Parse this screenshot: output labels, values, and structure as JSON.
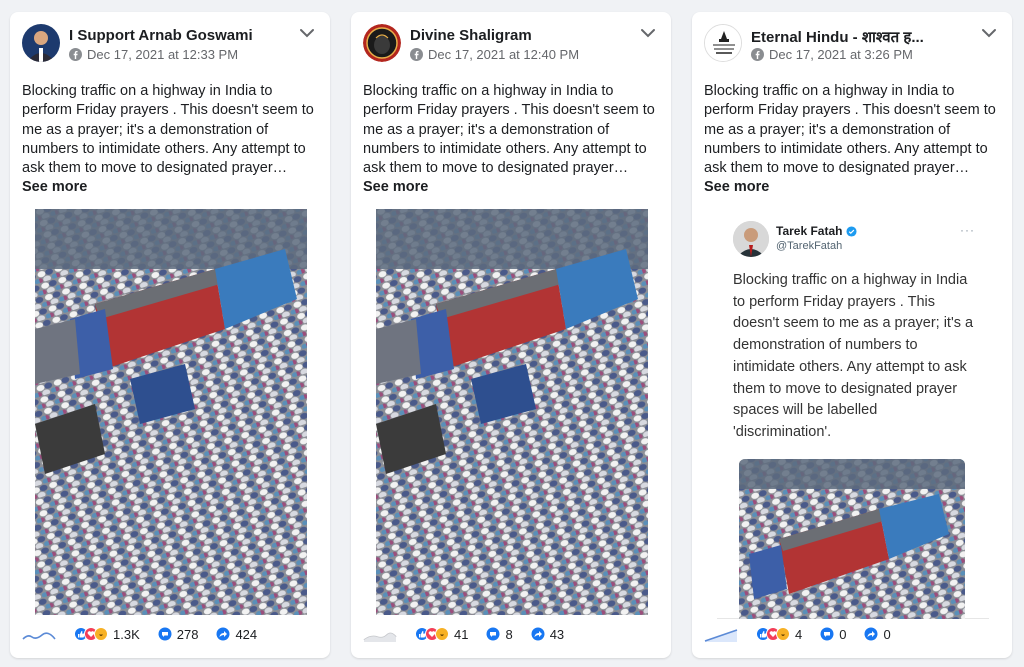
{
  "posts": [
    {
      "page_name": "I Support Arnab Goswami",
      "timestamp": "Dec 17, 2021 at 12:33 PM",
      "text": "Blocking traffic on a highway in India to perform Friday prayers . This doesn't seem to me as a prayer; it's a demonstration of numbers to intimidate others. Any attempt to ask them to move to designated prayer…",
      "see_more": "See more",
      "reactions": "1.3K",
      "comments": "278",
      "shares": "424"
    },
    {
      "page_name": "Divine Shaligram",
      "timestamp": "Dec 17, 2021 at 12:40 PM",
      "text": "Blocking traffic on a highway in India to perform Friday prayers . This doesn't seem to me as a prayer; it's a demonstration of numbers to intimidate others. Any attempt to ask them to move to designated prayer…",
      "see_more": "See more",
      "reactions": "41",
      "comments": "8",
      "shares": "43"
    },
    {
      "page_name": "Eternal Hindu - शाश्वत ह...",
      "timestamp": "Dec 17, 2021 at 3:26 PM",
      "text": "Blocking traffic on a highway in India to perform Friday prayers . This doesn't seem to me as a prayer; it's a demonstration of numbers to intimidate others. Any attempt to ask them to move to designated prayer…",
      "see_more": "See more",
      "reactions": "4",
      "comments": "0",
      "shares": "0",
      "tweet": {
        "author": "Tarek Fatah",
        "handle": "@TarekFatah",
        "more": "···",
        "text": "Blocking traffic on a highway in India to perform Friday prayers . This doesn't seem to me as a prayer; it's a demonstration of numbers to intimidate others. Any attempt to ask them to move to designated prayer spaces will be labelled 'discrimination'."
      }
    }
  ],
  "colors": {
    "like_blue": "#1877f2",
    "love_red": "#f33e58",
    "haha_yellow": "#f7b125",
    "icon_blue": "#1877f2",
    "muted": "#65676b",
    "twitter_blue": "#1d9bf0"
  },
  "icons": {
    "header_more": "chevron-down-icon",
    "platform": "facebook-icon",
    "reactions": "like-love-haha-icons",
    "comments": "comment-bubble-icon",
    "shares": "share-arrow-icon",
    "trend": "sparkline-icon",
    "verified": "verified-badge-icon"
  }
}
